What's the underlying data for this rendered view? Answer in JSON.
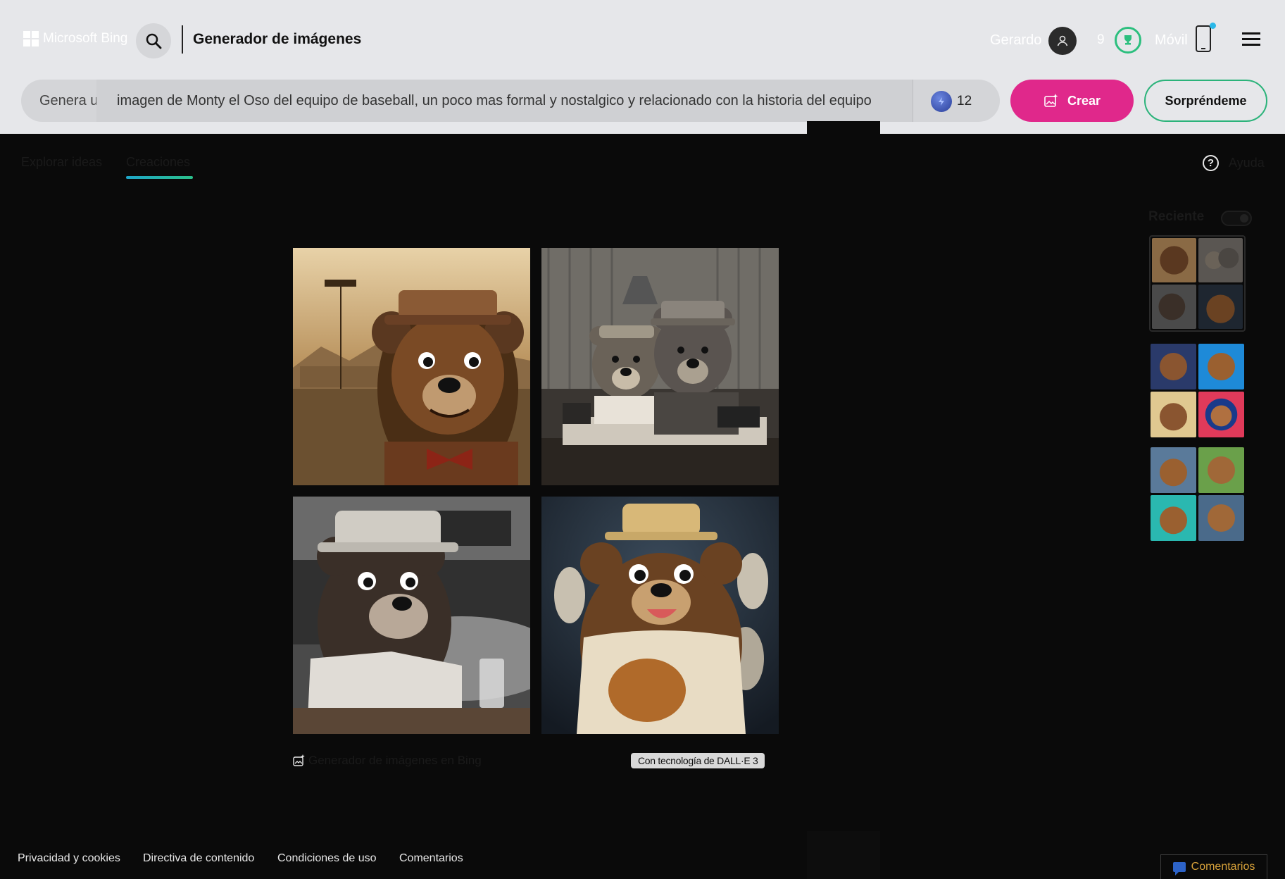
{
  "header": {
    "logo_text": "Microsoft Bing",
    "product_title": "Generador de imágenes",
    "user_name": "Gerardo",
    "reward_points": "9",
    "mobile_label": "Móvil"
  },
  "prompt": {
    "placeholder": "Genera u",
    "value": "imagen de Monty el Oso del equipo de baseball, un poco mas formal y nostalgico y relacionado con la historia del equipo",
    "boosts": "12"
  },
  "actions": {
    "create_label": "Crear",
    "surprise_label": "Sorpréndeme"
  },
  "tabs": [
    {
      "label": "Explorar ideas",
      "active": false
    },
    {
      "label": "Creaciones",
      "active": true
    }
  ],
  "help_label": "Ayuda",
  "result": {
    "brand_caption": "Generador de imágenes en Bing",
    "powered_by": "Con tecnología de DALL·E 3",
    "images": [
      {
        "description": "sepia bear mascot with hat and bow tie at ballpark"
      },
      {
        "description": "two bears at vintage office desk with typewriter"
      },
      {
        "description": "black and white bear mascot in stadium with drink"
      },
      {
        "description": "bear mascot in Bears baseball jersey with glove"
      }
    ]
  },
  "recent": {
    "label": "Reciente",
    "groups": 3
  },
  "footer": {
    "links": [
      "Privacidad y cookies",
      "Directiva de contenido",
      "Condiciones de uso",
      "Comentarios"
    ],
    "feedback_button": "Comentarios"
  },
  "colors": {
    "accent_pink": "#e0288b",
    "accent_green": "#2bb37a",
    "background": "#0a0a0a",
    "header_bg": "#e6e7ea"
  }
}
